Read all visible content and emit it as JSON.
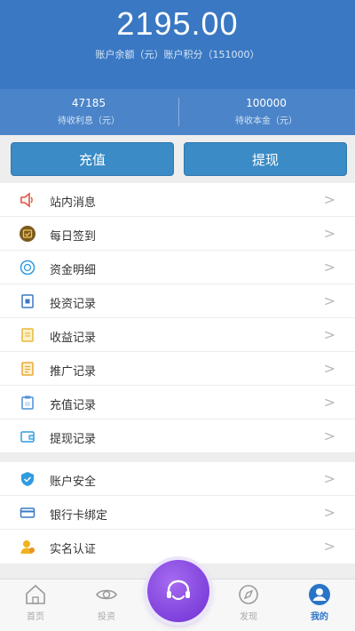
{
  "header": {
    "balance": "2195.00",
    "balance_sub": "账户余额（元）账户积分（151000）"
  },
  "stats": {
    "left_value": "47185",
    "left_label": "待收利息（元）",
    "right_value": "100000",
    "right_label": "待收本金（元）"
  },
  "actions": {
    "charge": "充值",
    "withdraw": "提现"
  },
  "menu1": [
    {
      "label": "站内消息",
      "icon": "speaker-icon"
    },
    {
      "label": "每日签到",
      "icon": "checkin-icon"
    },
    {
      "label": "资金明细",
      "icon": "fund-detail-icon"
    },
    {
      "label": "投资记录",
      "icon": "investment-record-icon"
    },
    {
      "label": "收益记录",
      "icon": "income-record-icon"
    },
    {
      "label": "推广记录",
      "icon": "promotion-record-icon"
    },
    {
      "label": "充值记录",
      "icon": "recharge-record-icon"
    },
    {
      "label": "提现记录",
      "icon": "withdraw-record-icon"
    }
  ],
  "menu2": [
    {
      "label": "账户安全",
      "icon": "shield-icon"
    },
    {
      "label": "银行卡绑定",
      "icon": "bank-card-icon"
    },
    {
      "label": "实名认证",
      "icon": "user-verify-icon"
    }
  ],
  "chevron": ">",
  "tabs": [
    {
      "label": "首页",
      "icon": "home-icon"
    },
    {
      "label": "投资",
      "icon": "invest-icon"
    },
    {
      "label": "发现",
      "icon": "compass-icon"
    },
    {
      "label": "我的",
      "icon": "profile-icon"
    }
  ],
  "colors": {
    "header": "#3a78c3",
    "button": "#3a8bc6",
    "active_tab": "#2a74c8",
    "fab": "#7b3ae0"
  }
}
